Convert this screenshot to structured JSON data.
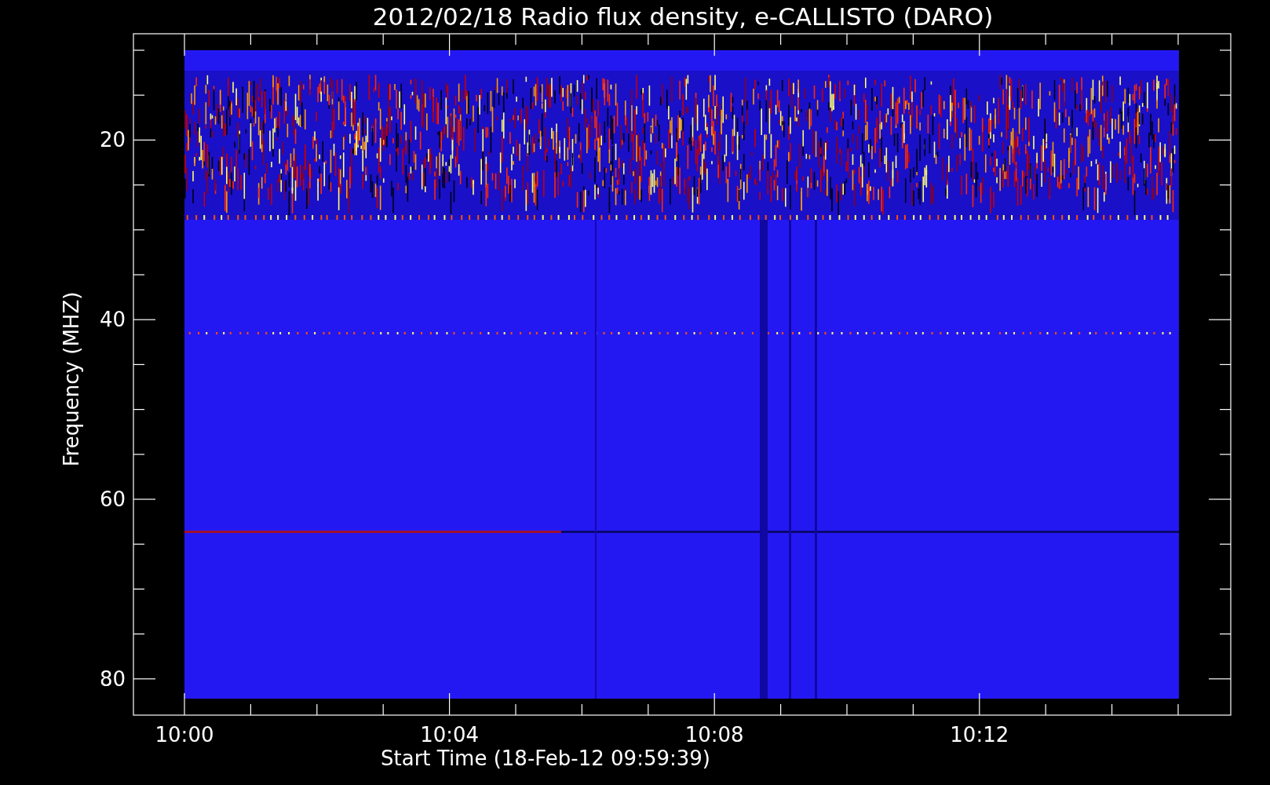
{
  "title": "2012/02/18  Radio flux density, e-CALLISTO (DARO)",
  "y_axis": {
    "label": "Frequency (MHZ)",
    "ticks": [
      "20",
      "40",
      "60",
      "80"
    ]
  },
  "x_axis": {
    "label": "Start Time (18-Feb-12 09:59:39)",
    "ticks": [
      "10:00",
      "10:04",
      "10:08",
      "10:12"
    ]
  }
}
